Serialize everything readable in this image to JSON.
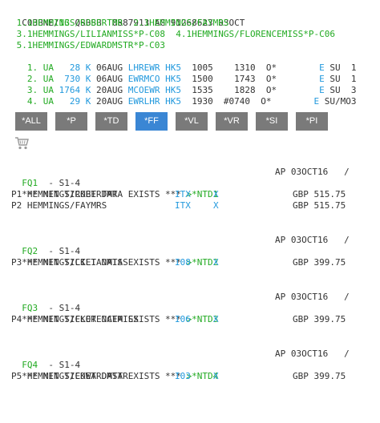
{
  "header": {
    "pnr_line": [
      "C03BNE/",
      "13",
      " QSBSB  0887913 AG 91268623 03OCT"
    ],
    "names": [
      " 1.1HEMMINGS/ROBERTMR  2.1HEMMINGS/FAYMRS",
      " 3.1HEMMINGS/LILIANMISS*P-C08  4.1HEMMINGS/FLORENCEMISS*P-C06",
      " 5.1HEMMINGS/EDWARDMSTR*P-C03"
    ]
  },
  "segments": [
    {
      "a": " 1. UA   ",
      "b": "28 K",
      "c": " 06AUG ",
      "d": "LHREWR HK5",
      "e": "  1005    1310  O*        ",
      "f": "E",
      "g": " SU  1"
    },
    {
      "a": " 2. UA  ",
      "b": "730 K",
      "c": " 06AUG ",
      "d": "EWRMCO HK5",
      "e": "  1500    1743  O*        ",
      "f": "E",
      "g": " SU  1"
    },
    {
      "a": " 3. UA ",
      "b": "1764 K",
      "c": " 20AUG ",
      "d": "MCOEWR HK5",
      "e": "  1535    1828  O*        ",
      "f": "E",
      "g": " SU  3"
    },
    {
      "a": " 4. UA   ",
      "b": "29 K",
      "c": " 20AUG ",
      "d": "EWRLHR HK5",
      "e": "  1930  #0740  O*        ",
      "f": "E",
      "g": " SU/MO3"
    }
  ],
  "buttons": [
    {
      "label": "*ALL",
      "active": false
    },
    {
      "label": "*P",
      "active": false
    },
    {
      "label": "*TD",
      "active": false
    },
    {
      "label": "*FF",
      "active": true
    },
    {
      "label": "*VL",
      "active": false
    },
    {
      "label": "*VR",
      "active": false
    },
    {
      "label": "*SI",
      "active": false
    },
    {
      "label": "*PI",
      "active": false
    }
  ],
  "cart_icon": "shopping-cart-icon",
  "colors": {
    "text": "#333333",
    "green": "#22aa22",
    "blue": "#2299dd",
    "button": "#7a7a7a",
    "button_active": "#3a86d4"
  },
  "fares": [
    {
      "fq": "FQ1",
      "seg": "  - S1-4",
      "ap": "AP 03OCT16   /",
      "net_text": "*** NET TICKET DATA EXISTS *** ",
      "net_link": ">*NTD1",
      "pax": [
        {
          "name": "P1 HEMMINGS/ROBERTMR",
          "type": "ITX",
          "x": "X",
          "amount": "GBP 515.75"
        },
        {
          "name": "P2 HEMMINGS/FAYMRS",
          "type": "ITX",
          "x": "X",
          "amount": "GBP 515.75"
        }
      ]
    },
    {
      "fq": "FQ2",
      "seg": "  - S1-4",
      "ap": "AP 03OCT16   /",
      "net_text": "*** NET TICKET DATA EXISTS *** ",
      "net_link": ">*NTD2",
      "pax": [
        {
          "name": "P3 HEMMINGS/LILIANMISS",
          "type": "I08",
          "x": "X",
          "amount": "GBP 399.75"
        }
      ]
    },
    {
      "fq": "FQ3",
      "seg": "  - S1-4",
      "ap": "AP 03OCT16   /",
      "net_text": "*** NET TICKET DATA EXISTS *** ",
      "net_link": ">*NTD3",
      "pax": [
        {
          "name": "P4 HEMMINGS/FLORENCEMISS",
          "type": "I06",
          "x": "X",
          "amount": "GBP 399.75"
        }
      ]
    },
    {
      "fq": "FQ4",
      "seg": "  - S1-4",
      "ap": "AP 03OCT16   /",
      "net_text": "*** NET TICKET DATA EXISTS *** ",
      "net_link": ">*NTD4",
      "pax": [
        {
          "name": "P5 HEMMINGS/EDWARDMSTR",
          "type": "I03",
          "x": "X",
          "amount": "GBP 399.75"
        }
      ]
    }
  ]
}
